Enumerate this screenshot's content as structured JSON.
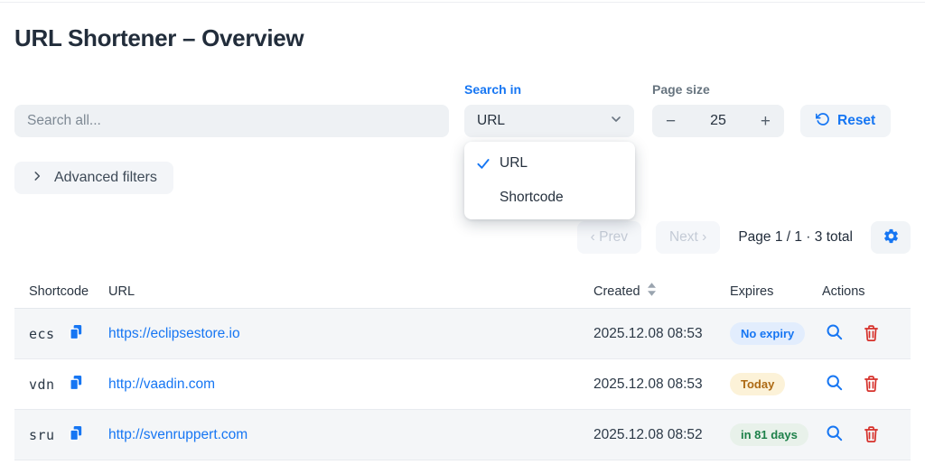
{
  "page": {
    "title": "URL Shortener – Overview"
  },
  "colors": {
    "accent": "#1676f3",
    "danger": "#d6312b",
    "badge_info_text": "#1676f3",
    "badge_warning_text": "#ad6a14",
    "badge_success_text": "#1d8049",
    "row_stripe": "#f4f6f8"
  },
  "icons": {
    "select_chevron": "chevron-down-icon",
    "selected_option": "checkmark-icon",
    "reset": "rotate-ccw-icon",
    "advanced": "chevron-right-icon",
    "settings": "gear-icon",
    "sort": "sort-arrows-icon",
    "copy": "copy-icon",
    "view": "magnifier-icon",
    "delete": "trash-icon"
  },
  "toolbar": {
    "search_placeholder": "Search all...",
    "search_in": {
      "label": "Search in",
      "value": "URL",
      "options": [
        "URL",
        "Shortcode"
      ],
      "selected_index": 0
    },
    "page_size": {
      "label": "Page size",
      "minus": "−",
      "value": "25",
      "plus": "+"
    },
    "reset_label": "Reset"
  },
  "filters": {
    "advanced_label": "Advanced filters"
  },
  "pagination": {
    "prev_label": "‹ Prev",
    "next_label": "Next ›",
    "status": "Page 1 / 1 · 3 total"
  },
  "table": {
    "columns": [
      "Shortcode",
      "URL",
      "Created",
      "Expires",
      "Actions"
    ],
    "rows": [
      {
        "shortcode": "ecs",
        "url": "https://eclipsestore.io",
        "created": "2025.12.08 08:53",
        "expires": "No expiry",
        "expires_kind": "info"
      },
      {
        "shortcode": "vdn",
        "url": "http://vaadin.com",
        "created": "2025.12.08 08:53",
        "expires": "Today",
        "expires_kind": "warning"
      },
      {
        "shortcode": "sru",
        "url": "http://svenruppert.com",
        "created": "2025.12.08 08:52",
        "expires": "in 81 days",
        "expires_kind": "success"
      }
    ]
  }
}
